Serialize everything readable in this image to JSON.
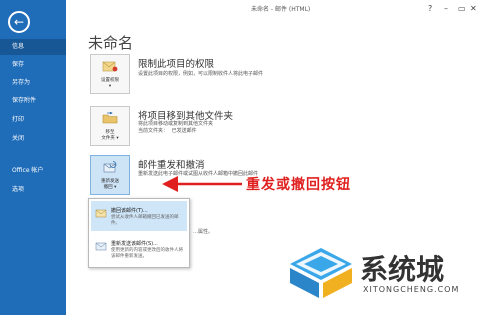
{
  "titlebar": {
    "title": "未命名 - 邮件 (HTML)",
    "help": "?",
    "minimize": "–",
    "restore": "▭",
    "close": "✕"
  },
  "sidebar": {
    "back_icon": "←",
    "items": [
      {
        "label": "信息",
        "active": true
      },
      {
        "label": "保存"
      },
      {
        "label": "另存为"
      },
      {
        "label": "保存附件"
      },
      {
        "label": "打印"
      },
      {
        "label": "关闭"
      },
      {
        "label": "Office 帐户"
      },
      {
        "label": "选项"
      }
    ]
  },
  "main": {
    "page_title": "未命名",
    "sections": [
      {
        "card_label": "设置权限",
        "card_arrow": "▾",
        "title": "限制此项目的权限",
        "desc": "设置此项目的权限，例如，可以限制收件人将此电子邮件"
      },
      {
        "card_label_1": "移至",
        "card_label_2": "文件夹 ▾",
        "title": "将项目移到其他文件夹",
        "desc": "将此项目移动或复制到其他文件夹",
        "sub_label": "当前文件夹：",
        "sub_value": "已发送邮件"
      },
      {
        "card_label_1": "重新发送",
        "card_label_2": "撤回 ▾",
        "title": "邮件重发和撤消",
        "desc": "重新发送此电子邮件或试图从收件人邮箱中撤回此邮件"
      }
    ],
    "menu": [
      {
        "title": "撤回该邮件(T)...",
        "desc": "尝试从收件人邮箱撤回已发送的邮件。"
      },
      {
        "title": "重新发送该邮件(S)...",
        "desc": "使用更新的内容或更改后的收件人将该邮件重新发送。"
      }
    ],
    "behind_text": "…属性。"
  },
  "annotation": {
    "text": "重发或撤回按钮",
    "color": "#e02020"
  },
  "watermark": {
    "text": "系统城",
    "url": "XITONGCHENG.COM"
  },
  "colors": {
    "sidebar": "#1f6cb8",
    "sidebar_active": "#175795",
    "highlight": "#cfe5f8"
  }
}
